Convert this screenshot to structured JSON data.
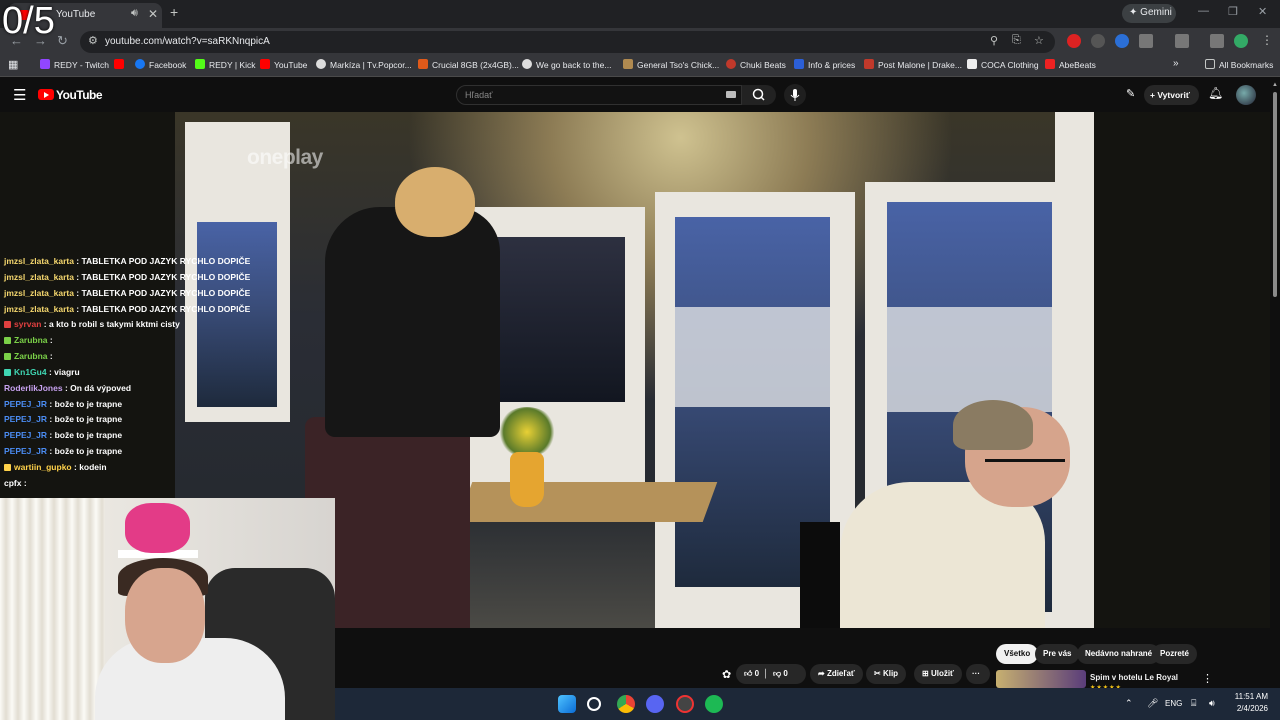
{
  "overlay": {
    "counter": "0/5"
  },
  "browser": {
    "tab_title": "YouTube",
    "url": "youtube.com/watch?v=saRKNnqpicA",
    "gemini_label": "Gemini",
    "bookmarks": [
      {
        "label": "REDY - Twitch",
        "color": "#9146ff"
      },
      {
        "label": "",
        "color": "#ff0000"
      },
      {
        "label": "Facebook",
        "color": "#1877f2"
      },
      {
        "label": "REDY | Kick",
        "color": "#53fc18"
      },
      {
        "label": "YouTube",
        "color": "#ff0000"
      },
      {
        "label": "Markíza | Tv.Popcor...",
        "color": "#ffffff"
      },
      {
        "label": "Crucial 8GB (2x4GB)...",
        "color": "#e05a1a"
      },
      {
        "label": "We go back to the...",
        "color": "#ffffff"
      },
      {
        "label": "General Tso's Chick...",
        "color": "#b08a50"
      },
      {
        "label": "Chuki Beats",
        "color": "#c0392b"
      },
      {
        "label": "Info & prices",
        "color": "#2c5fd6"
      },
      {
        "label": "Post Malone | Drake...",
        "color": "#c0392b"
      },
      {
        "label": "COCA Clothing",
        "color": "#ffffff"
      },
      {
        "label": "AbeBeats",
        "color": "#e22"
      }
    ],
    "all_bookmarks_label": "All Bookmarks"
  },
  "youtube": {
    "logo_text": "YouTube",
    "search_placeholder": "Hľadať",
    "create_label": "Vytvoriť",
    "video_watermark": "oneplay"
  },
  "chat": [
    {
      "user": "jmzsl_zlata_karta",
      "msg": "TABLETKA POD JAZYK RYCHLO DOPIČE",
      "color": "#f5d76e"
    },
    {
      "user": "jmzsl_zlata_karta",
      "msg": "TABLETKA POD JAZYK RYCHLO DOPIČE",
      "color": "#f5d76e"
    },
    {
      "user": "jmzsl_zlata_karta",
      "msg": "TABLETKA POD JAZYK RYCHLO DOPIČE",
      "color": "#f5d76e"
    },
    {
      "user": "jmzsl_zlata_karta",
      "msg": "TABLETKA POD JAZYK RYCHLO DOPIČE",
      "color": "#f5d76e"
    },
    {
      "user": "syrvan",
      "msg": "a kto b robil s takymi kktmi cisty",
      "color": "#e04040"
    },
    {
      "user": "Zarubna",
      "msg": "",
      "color": "#7bd148"
    },
    {
      "user": "Zarubna",
      "msg": "",
      "color": "#7bd148"
    },
    {
      "user": "Kn1Gu4",
      "msg": "viagru",
      "color": "#3fd6b3"
    },
    {
      "user": "RoderlikJones",
      "msg": "On dá výpoved",
      "color": "#c8a2f0"
    },
    {
      "user": "PEPEJ_JR",
      "msg": "bože to je trapne",
      "color": "#4b8cf2"
    },
    {
      "user": "PEPEJ_JR",
      "msg": "bože to je trapne",
      "color": "#4b8cf2"
    },
    {
      "user": "PEPEJ_JR",
      "msg": "bože to je trapne",
      "color": "#4b8cf2"
    },
    {
      "user": "PEPEJ_JR",
      "msg": "bože to je trapne",
      "color": "#4b8cf2"
    },
    {
      "user": "wartiin_gupko",
      "msg": "kodein",
      "color": "#ffd24a"
    },
    {
      "user": "cpfx",
      "msg": "",
      "color": "#ffffff"
    }
  ],
  "filters": [
    "Všetko",
    "Pre vás",
    "Nedávno nahrané",
    "Pozreté"
  ],
  "actions": {
    "likes": "0",
    "dislikes": "0",
    "share": "Zdieľať",
    "clip": "Klip",
    "save": "Uložiť"
  },
  "recommended": {
    "title": "Spim v hotelu Le Royal"
  },
  "taskbar": {
    "language": "ENG",
    "time": "11:51 AM",
    "date": "2/4/2026"
  }
}
